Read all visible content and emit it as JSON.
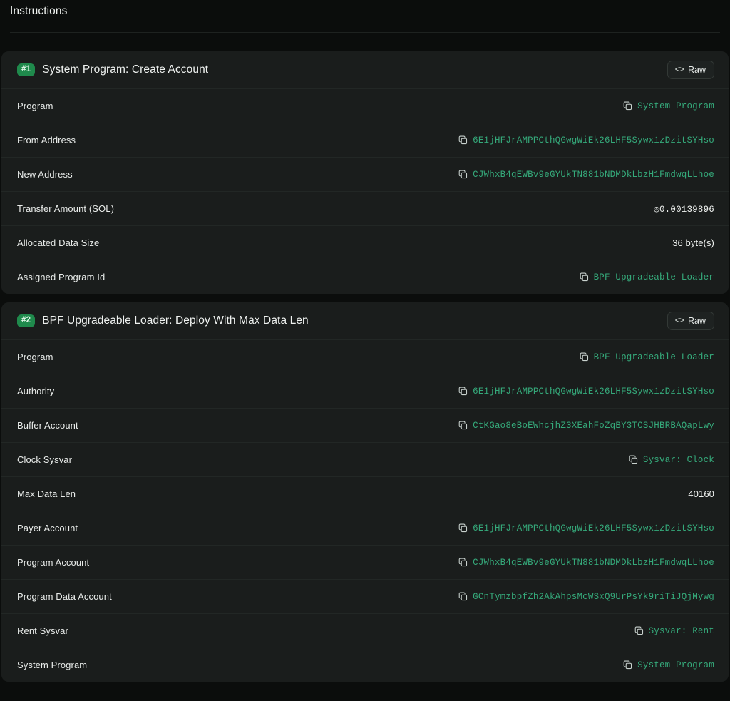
{
  "header": {
    "title": "Instructions"
  },
  "icons": {
    "copy": "copy-icon",
    "code": "code-brackets-icon"
  },
  "colors": {
    "page_bg": "#0b0d0c",
    "card_bg": "#1a1d1c",
    "badge_green": "#1f8a4c",
    "mono_green": "#35a97a",
    "text": "#eef1ef",
    "divider": "#222725"
  },
  "instructions": [
    {
      "badge": "#1",
      "title": "System Program: Create Account",
      "raw_label": "Raw",
      "raw_icon": "<>",
      "rows": [
        {
          "label": "Program",
          "value": "System Program",
          "style": "mono",
          "copy": true
        },
        {
          "label": "From Address",
          "value": "6E1jHFJrAMPPCthQGwgWiEk26LHF5Sywx1zDzitSYHso",
          "style": "mono",
          "copy": true
        },
        {
          "label": "New Address",
          "value": "CJWhxB4qEWBv9eGYUkTN881bNDMDkLbzH1FmdwqLLhoe",
          "style": "mono",
          "copy": true
        },
        {
          "label": "Transfer Amount (SOL)",
          "value": "◎0.00139896",
          "style": "amount",
          "copy": false
        },
        {
          "label": "Allocated Data Size",
          "value": "36 byte(s)",
          "style": "plain",
          "copy": false
        },
        {
          "label": "Assigned Program Id",
          "value": "BPF Upgradeable Loader",
          "style": "mono",
          "copy": true
        }
      ]
    },
    {
      "badge": "#2",
      "title": "BPF Upgradeable Loader: Deploy With Max Data Len",
      "raw_label": "Raw",
      "raw_icon": "<>",
      "rows": [
        {
          "label": "Program",
          "value": "BPF Upgradeable Loader",
          "style": "mono",
          "copy": true
        },
        {
          "label": "Authority",
          "value": "6E1jHFJrAMPPCthQGwgWiEk26LHF5Sywx1zDzitSYHso",
          "style": "mono",
          "copy": true
        },
        {
          "label": "Buffer Account",
          "value": "CtKGao8eBoEWhcjhZ3XEahFoZqBY3TCSJHBRBAQapLwy",
          "style": "mono",
          "copy": true
        },
        {
          "label": "Clock Sysvar",
          "value": "Sysvar: Clock",
          "style": "mono",
          "copy": true
        },
        {
          "label": "Max Data Len",
          "value": "40160",
          "style": "plain",
          "copy": false
        },
        {
          "label": "Payer Account",
          "value": "6E1jHFJrAMPPCthQGwgWiEk26LHF5Sywx1zDzitSYHso",
          "style": "mono",
          "copy": true
        },
        {
          "label": "Program Account",
          "value": "CJWhxB4qEWBv9eGYUkTN881bNDMDkLbzH1FmdwqLLhoe",
          "style": "mono",
          "copy": true
        },
        {
          "label": "Program Data Account",
          "value": "GCnTymzbpfZh2AkAhpsMcWSxQ9UrPsYk9riTiJQjMywg",
          "style": "mono",
          "copy": true
        },
        {
          "label": "Rent Sysvar",
          "value": "Sysvar: Rent",
          "style": "mono",
          "copy": true
        },
        {
          "label": "System Program",
          "value": "System Program",
          "style": "mono",
          "copy": true
        }
      ]
    }
  ]
}
